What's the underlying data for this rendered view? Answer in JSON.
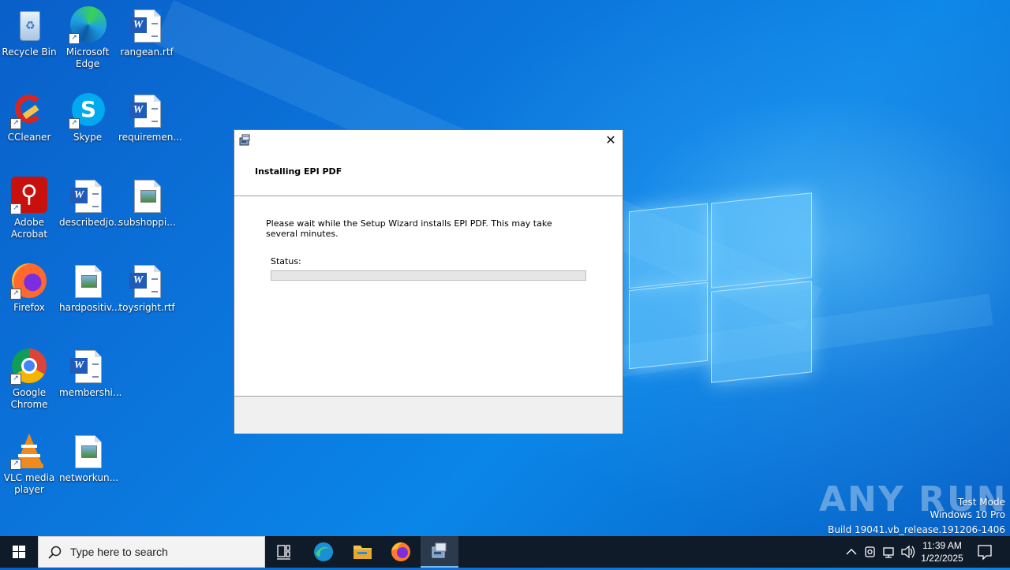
{
  "desktop": {
    "icons": [
      {
        "label": "Recycle Bin",
        "icon": "recycle-bin-icon"
      },
      {
        "label": "Microsoft Edge",
        "icon": "edge-icon"
      },
      {
        "label": "rangean.rtf",
        "icon": "word-document-icon"
      },
      {
        "label": "CCleaner",
        "icon": "ccleaner-icon"
      },
      {
        "label": "Skype",
        "icon": "skype-icon"
      },
      {
        "label": "requiremen...",
        "icon": "word-document-icon"
      },
      {
        "label": "Adobe Acrobat",
        "icon": "acrobat-icon"
      },
      {
        "label": "describedjo...",
        "icon": "word-document-icon"
      },
      {
        "label": "subshoppi...",
        "icon": "image-document-icon"
      },
      {
        "label": "Firefox",
        "icon": "firefox-icon"
      },
      {
        "label": "hardpositiv...",
        "icon": "image-document-icon"
      },
      {
        "label": "toysright.rtf",
        "icon": "word-document-icon"
      },
      {
        "label": "Google Chrome",
        "icon": "chrome-icon"
      },
      {
        "label": "membershi...",
        "icon": "word-document-icon"
      },
      {
        "label": "VLC media player",
        "icon": "vlc-icon"
      },
      {
        "label": "networkun...",
        "icon": "image-document-icon"
      }
    ]
  },
  "dialog": {
    "heading": "Installing EPI PDF",
    "body": "Please wait while the Setup Wizard installs EPI PDF.  This may take several minutes.",
    "status_label": "Status:",
    "progress": 0,
    "close_symbol": "✕"
  },
  "watermark": {
    "brand": "ANY RUN",
    "line1": "Test Mode",
    "line2": "Windows 10 Pro",
    "line3": "Build 19041.vb_release.191206-1406"
  },
  "taskbar": {
    "search_placeholder": "Type here to search",
    "time": "11:39 AM",
    "date": "1/22/2025"
  },
  "colors": {
    "taskbar_bg": "#101b29",
    "accent": "#76b9ed"
  }
}
